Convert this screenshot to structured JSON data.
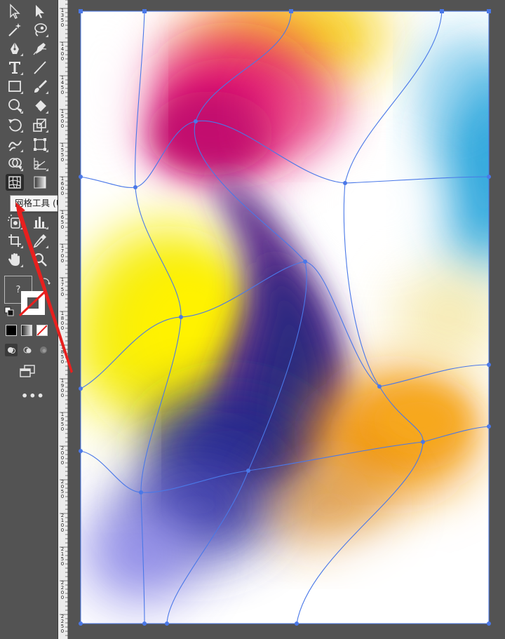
{
  "toolbar": {
    "tools": [
      {
        "name": "selection-tool",
        "icon": "selection-arrow-icon"
      },
      {
        "name": "direct-selection-tool",
        "icon": "direct-selection-icon"
      },
      {
        "name": "magic-wand-tool",
        "icon": "magic-wand-icon"
      },
      {
        "name": "lasso-tool",
        "icon": "lasso-icon"
      },
      {
        "name": "pen-tool",
        "icon": "pen-icon"
      },
      {
        "name": "curvature-tool",
        "icon": "curvature-icon"
      },
      {
        "name": "type-tool",
        "icon": "type-icon",
        "glyph": "T"
      },
      {
        "name": "line-segment-tool",
        "icon": "line-icon"
      },
      {
        "name": "rectangle-tool",
        "icon": "rectangle-icon"
      },
      {
        "name": "paintbrush-tool",
        "icon": "paintbrush-icon"
      },
      {
        "name": "shaper-tool",
        "icon": "shaper-icon"
      },
      {
        "name": "eraser-tool",
        "icon": "eraser-icon"
      },
      {
        "name": "rotate-tool",
        "icon": "rotate-icon"
      },
      {
        "name": "scale-tool",
        "icon": "scale-icon"
      },
      {
        "name": "warp-tool",
        "icon": "warp-icon"
      },
      {
        "name": "free-transform-tool",
        "icon": "free-transform-icon"
      },
      {
        "name": "shape-builder-tool",
        "icon": "shape-builder-icon"
      },
      {
        "name": "perspective-grid-tool",
        "icon": "perspective-grid-icon"
      },
      {
        "name": "mesh-tool",
        "icon": "mesh-icon"
      },
      {
        "name": "gradient-tool",
        "icon": "gradient-icon"
      },
      {
        "name": "symbol-sprayer-tool",
        "icon": "symbol-sprayer-icon"
      },
      {
        "name": "column-graph-tool",
        "icon": "column-graph-icon"
      },
      {
        "name": "artboard-tool",
        "icon": "artboard-icon"
      },
      {
        "name": "eyedropper-tool",
        "icon": "eyedropper-icon"
      },
      {
        "name": "hand-tool",
        "icon": "hand-icon"
      },
      {
        "name": "zoom-tool",
        "icon": "zoom-icon"
      }
    ],
    "tooltip": "网格工具 (U)",
    "fill_label": "?",
    "more_label": "•••",
    "colors": {
      "panel_bg": "#535353",
      "icon": "#e6e6e6",
      "tooltip_bg": "#f5f5f5",
      "arrow": "#e8201e"
    }
  },
  "ruler": {
    "labels": [
      "1350",
      "1400",
      "1450",
      "1500",
      "1550",
      "1600",
      "1650",
      "1700",
      "1750",
      "1800",
      "1850",
      "1900",
      "1950",
      "2000",
      "2050",
      "2100",
      "2150",
      "2200",
      "2250"
    ]
  },
  "artboard": {
    "mesh_color": "#4a78e8",
    "gradient_colors": {
      "yellow": "#f7ee0a",
      "magenta": "#e0186e",
      "indigo": "#2b2a80",
      "orange": "#f29a12",
      "cyan": "#2aa6dc",
      "violet": "#8c88e8",
      "white": "#ffffff"
    }
  }
}
